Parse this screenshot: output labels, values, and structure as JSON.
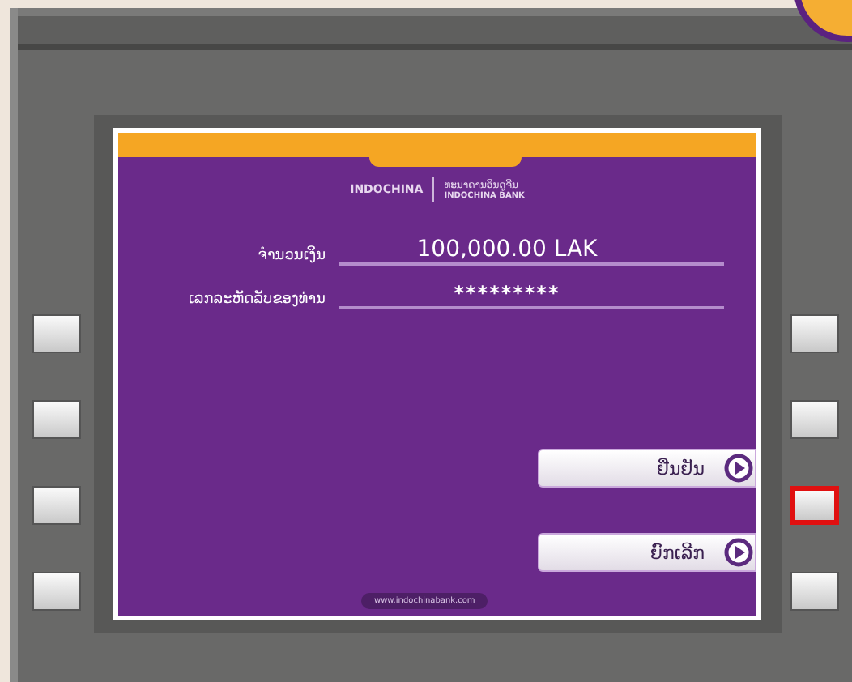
{
  "bank_logo": {
    "name": "INDOCHINA",
    "title_lao": "ທະນາຄານອິນດູຈີນ",
    "title_en": "INDOCHINA BANK"
  },
  "fields": [
    {
      "label": "ຈຳນວນເງິນ",
      "value": "100,000.00 LAK"
    },
    {
      "label": "ເລກລະຫັດລັບຂອງທ່ານ",
      "value": "*********"
    }
  ],
  "actions": [
    {
      "label": "ຢືນຢັນ"
    },
    {
      "label": "ຍົກເລີກ"
    }
  ],
  "website": "www.indochinabank.com",
  "side_keys": {
    "left": [
      {
        "selected": false
      },
      {
        "selected": false
      },
      {
        "selected": false
      },
      {
        "selected": false
      }
    ],
    "right": [
      {
        "selected": false
      },
      {
        "selected": false
      },
      {
        "selected": true
      },
      {
        "selected": false
      }
    ]
  }
}
